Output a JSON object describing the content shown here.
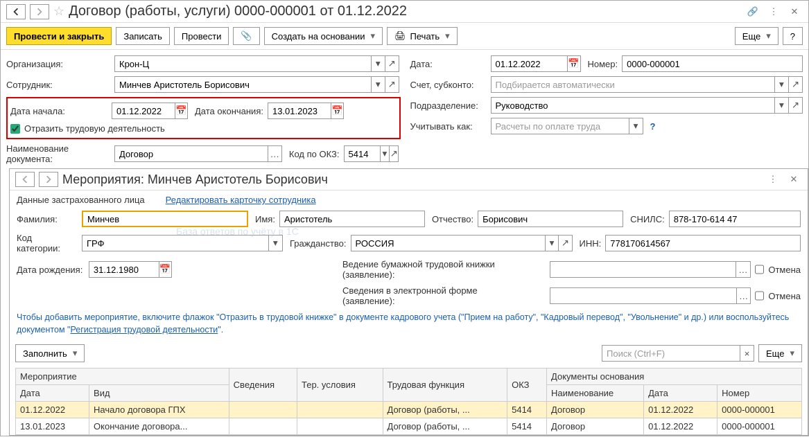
{
  "window": {
    "title": "Договор (работы, услуги) 0000-000001 от 01.12.2022"
  },
  "toolbar": {
    "post_close": "Провести и закрыть",
    "save": "Записать",
    "post": "Провести",
    "create_on_basis": "Создать на основании",
    "print": "Печать",
    "more": "Еще"
  },
  "form": {
    "org_label": "Организация:",
    "org_value": "Крон-Ц",
    "employee_label": "Сотрудник:",
    "employee_value": "Минчев Аристотель Борисович",
    "date_start_label": "Дата начала:",
    "date_start_value": "01.12.2022",
    "date_end_label": "Дата окончания:",
    "date_end_value": "13.01.2023",
    "activity_checkbox": "Отразить трудовую деятельность",
    "doc_name_label": "Наименование документа:",
    "doc_name_value": "Договор",
    "okz_label": "Код по ОКЗ:",
    "okz_value": "5414",
    "date_label": "Дата:",
    "date_value": "01.12.2022",
    "number_label": "Номер:",
    "number_value": "0000-000001",
    "account_label": "Счет, субконто:",
    "account_placeholder": "Подбирается автоматически",
    "department_label": "Подразделение:",
    "department_value": "Руководство",
    "consider_label": "Учитывать как:",
    "consider_placeholder": "Расчеты по оплате труда"
  },
  "sub": {
    "title": "Мероприятия: Минчев Аристотель Борисович",
    "insured_label": "Данные застрахованного лица",
    "edit_card_link": "Редактировать карточку сотрудника",
    "lname_label": "Фамилия:",
    "lname_value": "Минчев",
    "fname_label": "Имя:",
    "fname_value": "Аристотель",
    "pname_label": "Отчество:",
    "pname_value": "Борисович",
    "snils_label": "СНИЛС:",
    "snils_value": "878-170-614 47",
    "cat_label": "Код категории:",
    "cat_value": "ГРФ",
    "citizen_label": "Гражданство:",
    "citizen_value": "РОССИЯ",
    "inn_label": "ИНН:",
    "inn_value": "778170614567",
    "birth_label": "Дата рождения:",
    "birth_value": "31.12.1980",
    "paper_label": "Ведение бумажной трудовой книжки (заявление):",
    "electronic_label": "Сведения в электронной форме (заявление):",
    "cancel": "Отмена",
    "hint1": "Чтобы добавить мероприятие, включите флажок \"Отразить в трудовой книжке\" в документе кадрового учета (\"Прием на работу\", \"Кадровый перевод\", \"Увольнение\" и др.) или воспользуйтесь документом \"",
    "hint_link": "Регистрация трудовой деятельности",
    "hint2": "\".",
    "fill_btn": "Заполнить",
    "search_placeholder": "Поиск (Ctrl+F)",
    "more": "Еще"
  },
  "table": {
    "headers": {
      "event": "Мероприятие",
      "info": "Сведения",
      "ter": "Тер. условия",
      "func": "Трудовая функция",
      "okz": "ОКЗ",
      "basis": "Документы основания",
      "date": "Дата",
      "kind": "Вид",
      "name": "Наименование",
      "number": "Номер"
    },
    "rows": [
      {
        "date": "01.12.2022",
        "kind": "Начало договора ГПХ",
        "info": "",
        "ter": "",
        "func": "Договор (работы, ...",
        "okz": "5414",
        "name": "Договор",
        "bdate": "01.12.2022",
        "num": "0000-000001"
      },
      {
        "date": "13.01.2023",
        "kind": "Окончание договора...",
        "info": "",
        "ter": "",
        "func": "Договор (работы, ...",
        "okz": "5414",
        "name": "Договор",
        "bdate": "01.12.2022",
        "num": "0000-000001"
      }
    ]
  }
}
